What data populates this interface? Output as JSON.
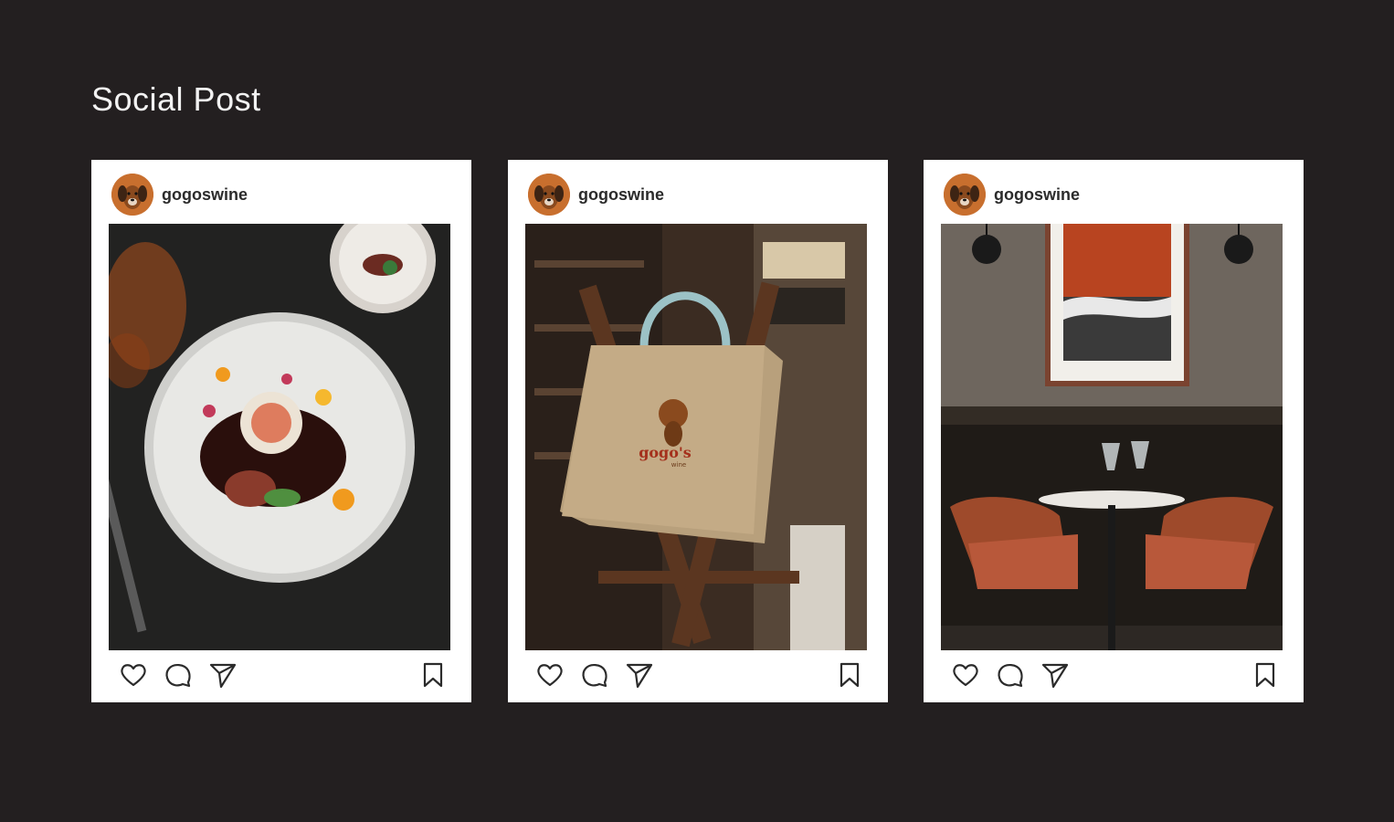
{
  "page": {
    "title": "Social Post",
    "background": "#231f20"
  },
  "colors": {
    "card": "#ffffff",
    "avatar_bg": "#c86f2e",
    "icon_stroke": "#2b2b2b"
  },
  "posts": [
    {
      "username": "gogoswine",
      "image_description_icon": "plated-dish-photo",
      "actions": [
        "heart-icon",
        "comment-icon",
        "send-icon",
        "bookmark-icon"
      ]
    },
    {
      "username": "gogoswine",
      "image_description_icon": "tote-bag-photo",
      "bag_logo": "gogo's",
      "bag_logo_sub": "wine",
      "actions": [
        "heart-icon",
        "comment-icon",
        "send-icon",
        "bookmark-icon"
      ]
    },
    {
      "username": "gogoswine",
      "image_description_icon": "restaurant-interior-photo",
      "actions": [
        "heart-icon",
        "comment-icon",
        "send-icon",
        "bookmark-icon"
      ]
    }
  ]
}
